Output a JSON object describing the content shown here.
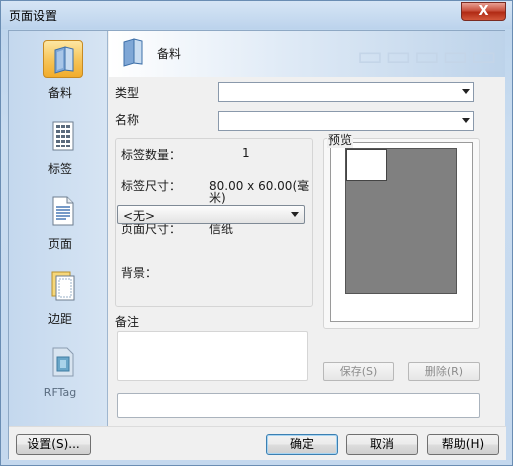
{
  "window": {
    "title": "页面设置",
    "close_glyph": "X"
  },
  "sidebar": {
    "items": [
      {
        "label": "备料",
        "icon": "folder-icon",
        "selected": true
      },
      {
        "label": "标签",
        "icon": "grid-table-icon",
        "selected": false
      },
      {
        "label": "页面",
        "icon": "document-page-icon",
        "selected": false
      },
      {
        "label": "边距",
        "icon": "stacked-pages-icon",
        "selected": false
      },
      {
        "label": "RFTag",
        "icon": "rfid-tag-icon",
        "selected": false
      }
    ]
  },
  "header": {
    "title": "备料",
    "icon": "folder-icon"
  },
  "form": {
    "type_label": "类型",
    "type_value": "",
    "name_label": "名称",
    "name_value": ""
  },
  "info": {
    "label_count_label": "标签数量：",
    "label_count_value": "1",
    "label_size_label": "标签尺寸：",
    "label_size_value_line1": "80.00 x 60.00(毫",
    "label_size_value_line2": "米)",
    "page_size_label": "页面尺寸：",
    "page_size_value": "信纸",
    "background_label": "背景：",
    "background_value": "<无>"
  },
  "preview": {
    "label": "预览"
  },
  "notes": {
    "label": "备注"
  },
  "actions": {
    "save_label": "保存(S)",
    "delete_label": "删除(R)"
  },
  "footer": {
    "settings_label": "设置(S)...",
    "ok_label": "确定",
    "cancel_label": "取消",
    "help_label": "帮助(H)"
  },
  "colors": {
    "selected_nav": "#f7c65c",
    "preview_area": "#808080",
    "close_button": "#c8503d"
  }
}
